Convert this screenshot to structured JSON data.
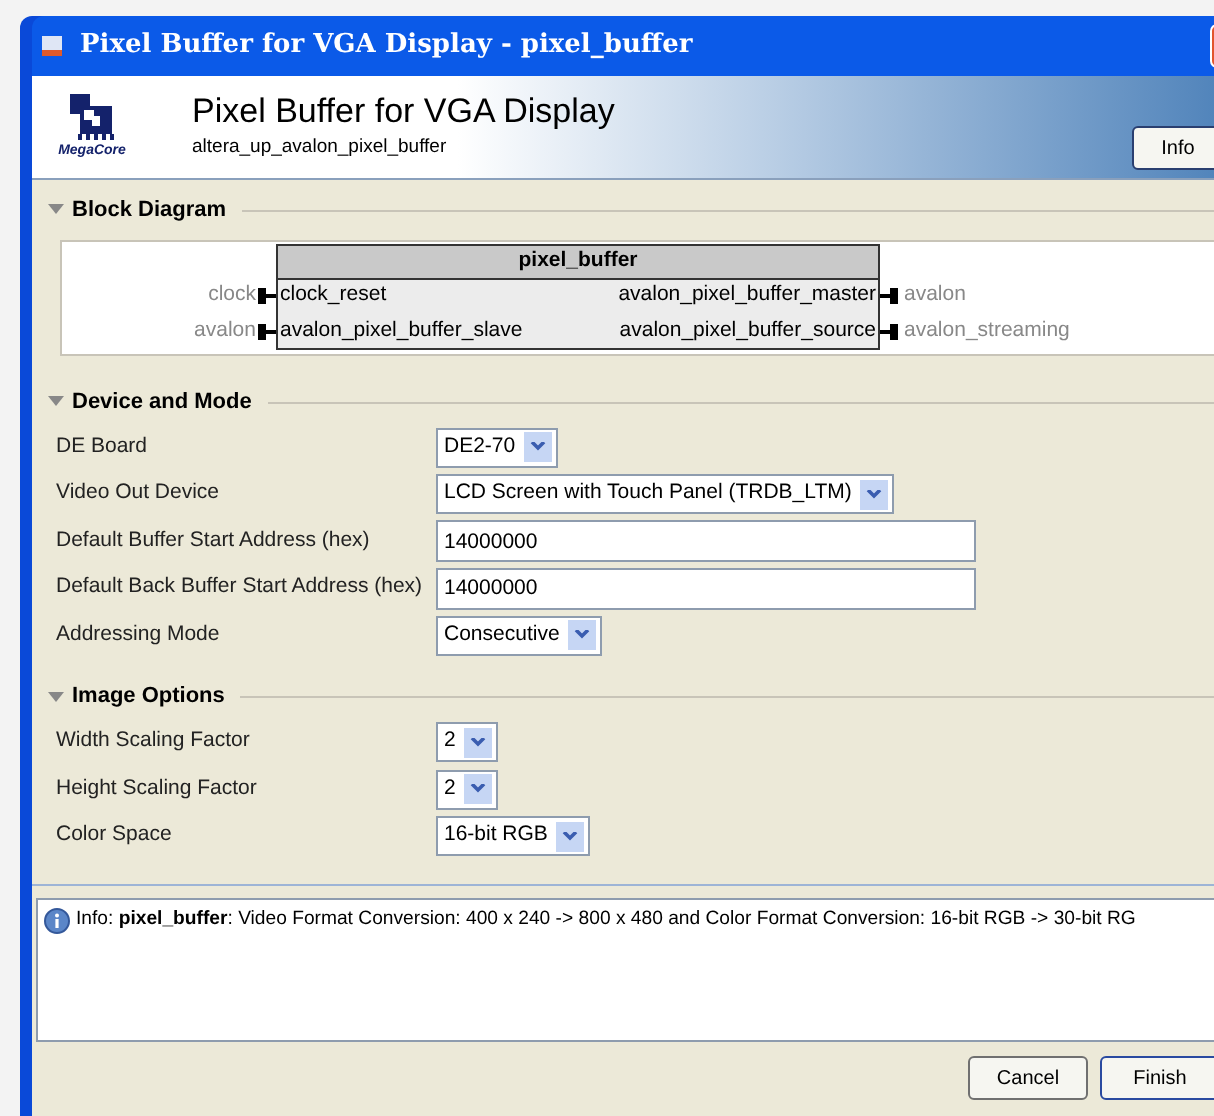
{
  "window": {
    "title": "Pixel Buffer for VGA Display - pixel_buffer"
  },
  "header": {
    "title": "Pixel Buffer for VGA Display",
    "subtitle": "altera_up_avalon_pixel_buffer",
    "logo_text": "MegaCore",
    "info_button": "Info"
  },
  "block_diagram": {
    "heading": "Block Diagram",
    "module": "pixel_buffer",
    "left_ports": [
      {
        "interface": "clock",
        "port": "clock_reset"
      },
      {
        "interface": "avalon",
        "port": "avalon_pixel_buffer_slave"
      }
    ],
    "right_ports": [
      {
        "interface": "avalon",
        "port": "avalon_pixel_buffer_master"
      },
      {
        "interface": "avalon_streaming",
        "port": "avalon_pixel_buffer_source"
      }
    ]
  },
  "sections": [
    {
      "heading": "Device and Mode",
      "fields": [
        {
          "label": "DE Board",
          "kind": "select",
          "value": "DE2-70"
        },
        {
          "label": "Video Out Device",
          "kind": "select",
          "value": "LCD Screen with Touch Panel (TRDB_LTM)"
        },
        {
          "label": "Default Buffer Start Address (hex)",
          "kind": "text",
          "value": "14000000"
        },
        {
          "label": "Default Back Buffer Start Address (hex)",
          "kind": "text",
          "value": "14000000"
        },
        {
          "label": "Addressing Mode",
          "kind": "select",
          "value": "Consecutive"
        }
      ]
    },
    {
      "heading": "Image Options",
      "fields": [
        {
          "label": "Width Scaling Factor",
          "kind": "select",
          "value": "2"
        },
        {
          "label": "Height Scaling Factor",
          "kind": "select",
          "value": "2"
        },
        {
          "label": "Color Space",
          "kind": "select",
          "value": "16-bit RGB"
        }
      ]
    }
  ],
  "messages": [
    {
      "text": "Info: **pixel_buffer**: Video Format Conversion: 400 x 240 -> 800 x 480 and Color Format Conversion: 16-bit RGB -> 30-bit RG"
    }
  ],
  "buttons": [
    "Cancel",
    "Finish"
  ]
}
